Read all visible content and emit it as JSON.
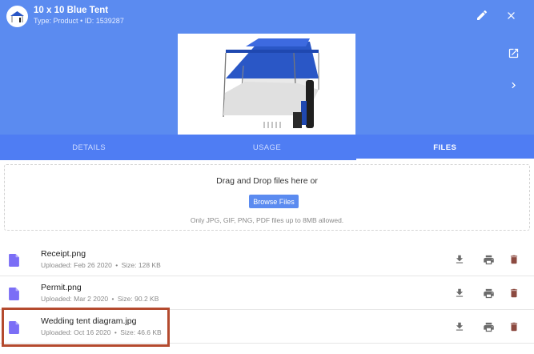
{
  "header": {
    "title": "10 x 10 Blue Tent",
    "subtitle_type_label": "Type:",
    "subtitle_type": "Product",
    "subtitle_id_label": "ID:",
    "subtitle_id": "1539287",
    "subtitle_sep": "•",
    "icons": {
      "edit": "pencil-icon",
      "close": "close-icon",
      "open_external": "open-in-new-icon",
      "next": "chevron-right-icon"
    },
    "image": {
      "description_icon": "tent-product-image",
      "canopy_color": "#2a57c6"
    }
  },
  "tabs": [
    {
      "label": "DETAILS",
      "active": false
    },
    {
      "label": "USAGE",
      "active": false
    },
    {
      "label": "FILES",
      "active": true
    }
  ],
  "dropzone": {
    "text": "Drag and Drop files here or",
    "button_label": "Browse Files",
    "note": "Only JPG, GIF, PNG, PDF files up to 8MB allowed."
  },
  "files": [
    {
      "name": "Receipt.png",
      "uploaded_label": "Uploaded:",
      "uploaded": "Feb 26 2020",
      "size_label": "Size:",
      "size": "128 KB",
      "sep": "•"
    },
    {
      "name": "Permit.png",
      "uploaded_label": "Uploaded:",
      "uploaded": "Mar 2 2020",
      "size_label": "Size:",
      "size": "90.2 KB",
      "sep": "•"
    },
    {
      "name": "Wedding tent diagram.jpg",
      "uploaded_label": "Uploaded:",
      "uploaded": "Oct 16 2020",
      "size_label": "Size:",
      "size": "46.6 KB",
      "sep": "•"
    }
  ],
  "row_icons": {
    "file": "file-icon",
    "download": "download-icon",
    "print": "print-icon",
    "delete": "delete-icon"
  },
  "colors": {
    "header_bg": "#5b8bf0",
    "tabs_bg": "#4f7df3",
    "file_icon": "#7b6ef6",
    "action_icon": "#6b6b6b",
    "delete_icon": "#8c4a40",
    "highlight": "#b44a2e"
  }
}
